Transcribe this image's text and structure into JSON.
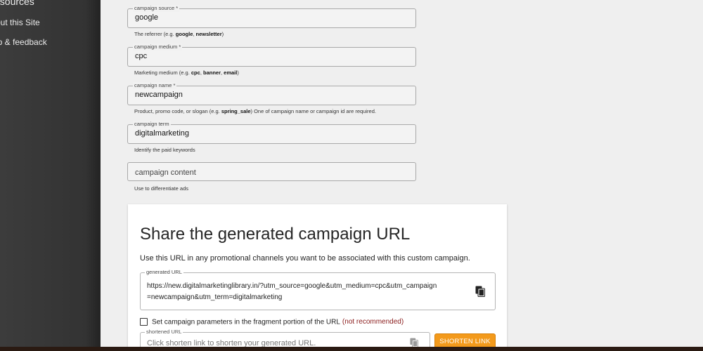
{
  "sidebar": {
    "heading": "esources",
    "items": [
      {
        "label": "out this Site"
      },
      {
        "label": "lp & feedback"
      }
    ]
  },
  "form": {
    "fields": [
      {
        "label": "campaign source *",
        "value": "google",
        "hint_parts": [
          "The referrer (e.g. ",
          "google",
          ", ",
          "newsletter",
          ")"
        ]
      },
      {
        "label": "campaign medium *",
        "value": "cpc",
        "hint_parts": [
          "Marketing medium (e.g. ",
          "cpc",
          ", ",
          "banner",
          ", ",
          "email",
          ")"
        ]
      },
      {
        "label": "campaign name *",
        "value": "newcampaign",
        "hint_parts": [
          "Product, promo code, or slogan (e.g. ",
          "spring_sale",
          ") One of campaign name or campaign id are required."
        ]
      },
      {
        "label": "campaign term",
        "value": "digitalmarketing",
        "hint": "Identify the paid keywords"
      },
      {
        "label": "",
        "placeholder": "campaign content",
        "hint": "Use to differentiate ads"
      }
    ]
  },
  "share": {
    "title": "Share the generated campaign URL",
    "description": "Use this URL in any promotional channels you want to be associated with this custom campaign.",
    "generated_url_label": "generated URL",
    "generated_url_line1": "https://new.digitalmarketinglibrary.in/?utm_source=google&utm_medium=cpc&utm_campaign",
    "generated_url_line2": "=newcampaign&utm_term=digitalmarketing",
    "fragment_label": "Set campaign parameters in the fragment portion of the URL",
    "fragment_note": "(not recommended)",
    "fragment_checked": false,
    "shortened_label": "shortened URL",
    "shortened_placeholder": "Click shorten link to shorten your generated URL.",
    "shorten_button": "SHORTEN LINK"
  },
  "icons": {
    "copy": "copy-icon"
  },
  "colors": {
    "accent": "#f39a1c",
    "warning_text": "#8a1c1c",
    "sidebar_bg": "#3a3a3a"
  }
}
